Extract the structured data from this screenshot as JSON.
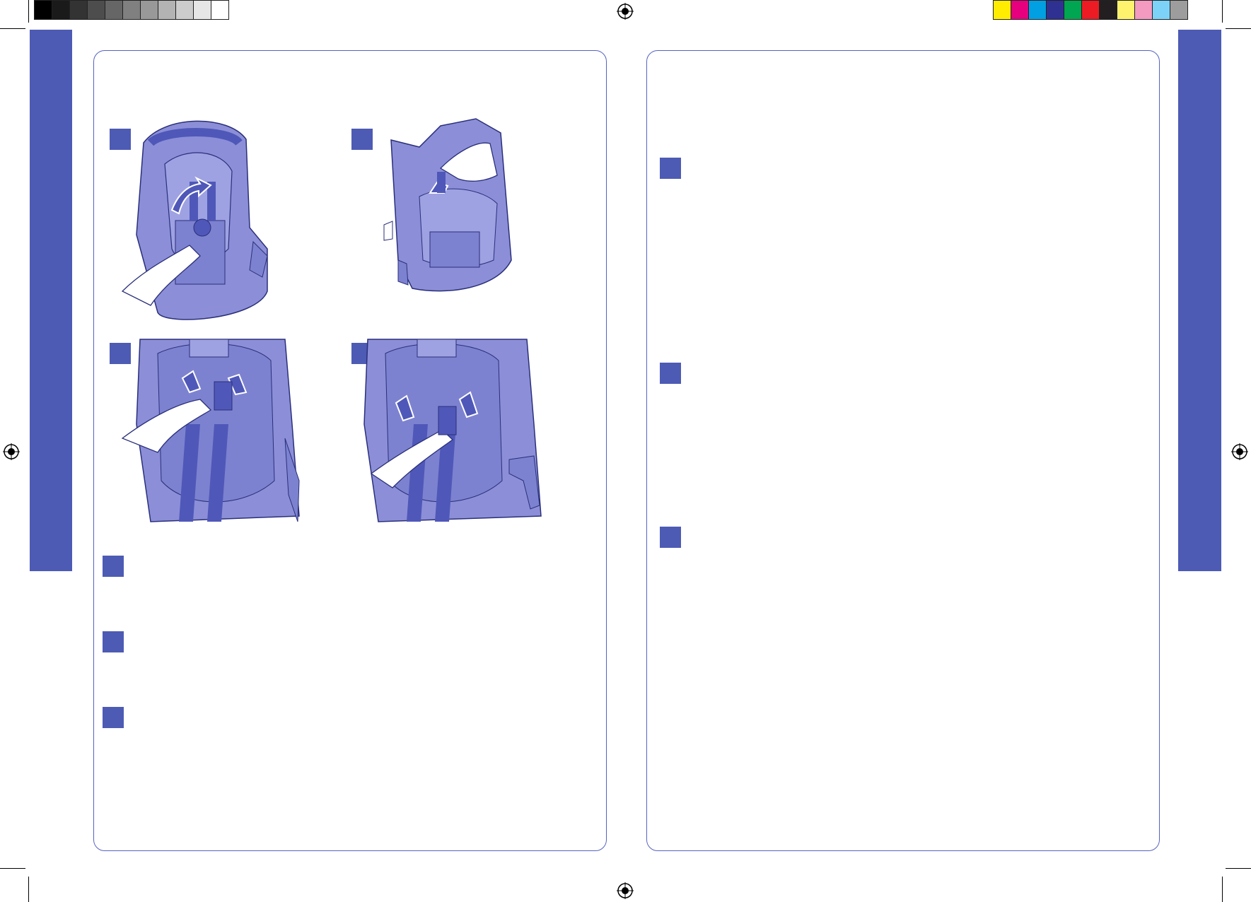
{
  "colors": {
    "accent": "#4d5bb4",
    "panel_border": "#5563c0",
    "illustration_fill": "#8c8fd8",
    "illustration_dark": "#4f58b8",
    "illustration_line": "#2a2f7a"
  },
  "color_bar_left": [
    "#000000",
    "#1a1a1a",
    "#333333",
    "#4d4d4d",
    "#666666",
    "#808080",
    "#999999",
    "#b3b3b3",
    "#cccccc",
    "#e6e6e6",
    "#ffffff"
  ],
  "color_bar_right": [
    "#ffec00",
    "#e6007e",
    "#00a0e3",
    "#2e3192",
    "#00a651",
    "#ed1c24",
    "#231f20",
    "#fff36e",
    "#f49ac1",
    "#7dd3f7",
    "#9d9d9d"
  ],
  "left_panel": {
    "figures": [
      {
        "name": "figure-1",
        "subject": "infant-carrier-front-view-hand-pressing-harness-release"
      },
      {
        "name": "figure-2",
        "subject": "infant-carrier-side-view-hand-on-seat-pad"
      },
      {
        "name": "figure-3",
        "subject": "harness-strap-close-up-hand-pulling-buckle"
      },
      {
        "name": "figure-4",
        "subject": "harness-strap-close-up-hand-fastening-buckle"
      }
    ],
    "step_markers": 3
  },
  "right_panel": {
    "step_markers": 3
  }
}
